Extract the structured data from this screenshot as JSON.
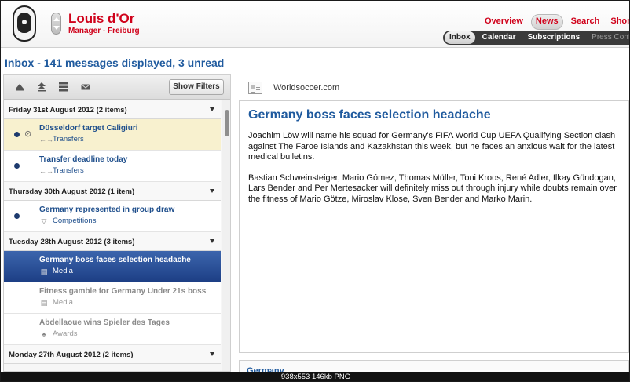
{
  "header": {
    "manager_name": "Louis d'Or",
    "manager_role": "Manager - Freiburg",
    "nav_top": [
      "Overview",
      "News",
      "Search",
      "Shor"
    ],
    "nav_top_active": "News",
    "nav_sub": [
      "Inbox",
      "Calendar",
      "Subscriptions",
      "Press Confer"
    ],
    "nav_sub_active": "Inbox"
  },
  "inbox": {
    "title": "Inbox - 141 messages displayed, 3 unread",
    "toolbar": {
      "icons": [
        "sort-up-icon",
        "collapse-all-icon",
        "list-view-icon",
        "mail-icon"
      ],
      "show_filters_label": "Show Filters"
    },
    "groups": [
      {
        "header": "Friday 31st August 2012 (2 items)",
        "messages": [
          {
            "subject": "Düsseldorf target Caligiuri",
            "category": "Transfers",
            "icon": "transfers-icon",
            "unread": true,
            "attachment": true,
            "state": "highlight"
          },
          {
            "subject": "Transfer deadline today",
            "category": "Transfers",
            "icon": "transfers-icon",
            "unread": true,
            "attachment": false,
            "state": "normal"
          }
        ]
      },
      {
        "header": "Thursday 30th August 2012 (1 item)",
        "messages": [
          {
            "subject": "Germany represented in group draw",
            "category": "Competitions",
            "icon": "shield-icon",
            "unread": true,
            "attachment": false,
            "state": "normal"
          }
        ]
      },
      {
        "header": "Tuesday 28th August 2012 (3 items)",
        "messages": [
          {
            "subject": "Germany boss faces selection headache",
            "category": "Media",
            "icon": "newspaper-icon",
            "unread": false,
            "attachment": false,
            "state": "selected"
          },
          {
            "subject": "Fitness gamble for Germany Under 21s boss",
            "category": "Media",
            "icon": "newspaper-icon",
            "unread": false,
            "attachment": false,
            "state": "read"
          },
          {
            "subject": "Abdellaoue wins Spieler des Tages",
            "category": "Awards",
            "icon": "trophy-icon",
            "unread": false,
            "attachment": false,
            "state": "read"
          }
        ]
      },
      {
        "header": "Monday 27th August 2012 (2 items)",
        "messages": []
      }
    ]
  },
  "article": {
    "source": "Worldsoccer.com",
    "title": "Germany boss faces selection headache",
    "paragraphs": [
      "Joachim Löw will name his squad for Germany's FIFA World Cup UEFA Qualifying Section clash against The Faroe Islands and Kazakhstan this week, but he faces an anxious wait for the latest medical bulletins.",
      "Bastian Schweinsteiger, Mario Gómez, Thomas Müller, Toni Kroos, René Adler, Ilkay Gündogan, Lars Bender and Per Mertesacker will definitely miss out through injury while doubts remain over the fitness of Mario Götze, Miroslav Klose, Sven Bender and Marko Marin."
    ],
    "next_card_title": "Germany"
  },
  "caption": "938x553 146kb PNG",
  "colors": {
    "accent_red": "#d0021b",
    "link_blue": "#1f5a9e",
    "selected_row": "#2a4f96",
    "highlight_row": "#f8f1cf"
  }
}
